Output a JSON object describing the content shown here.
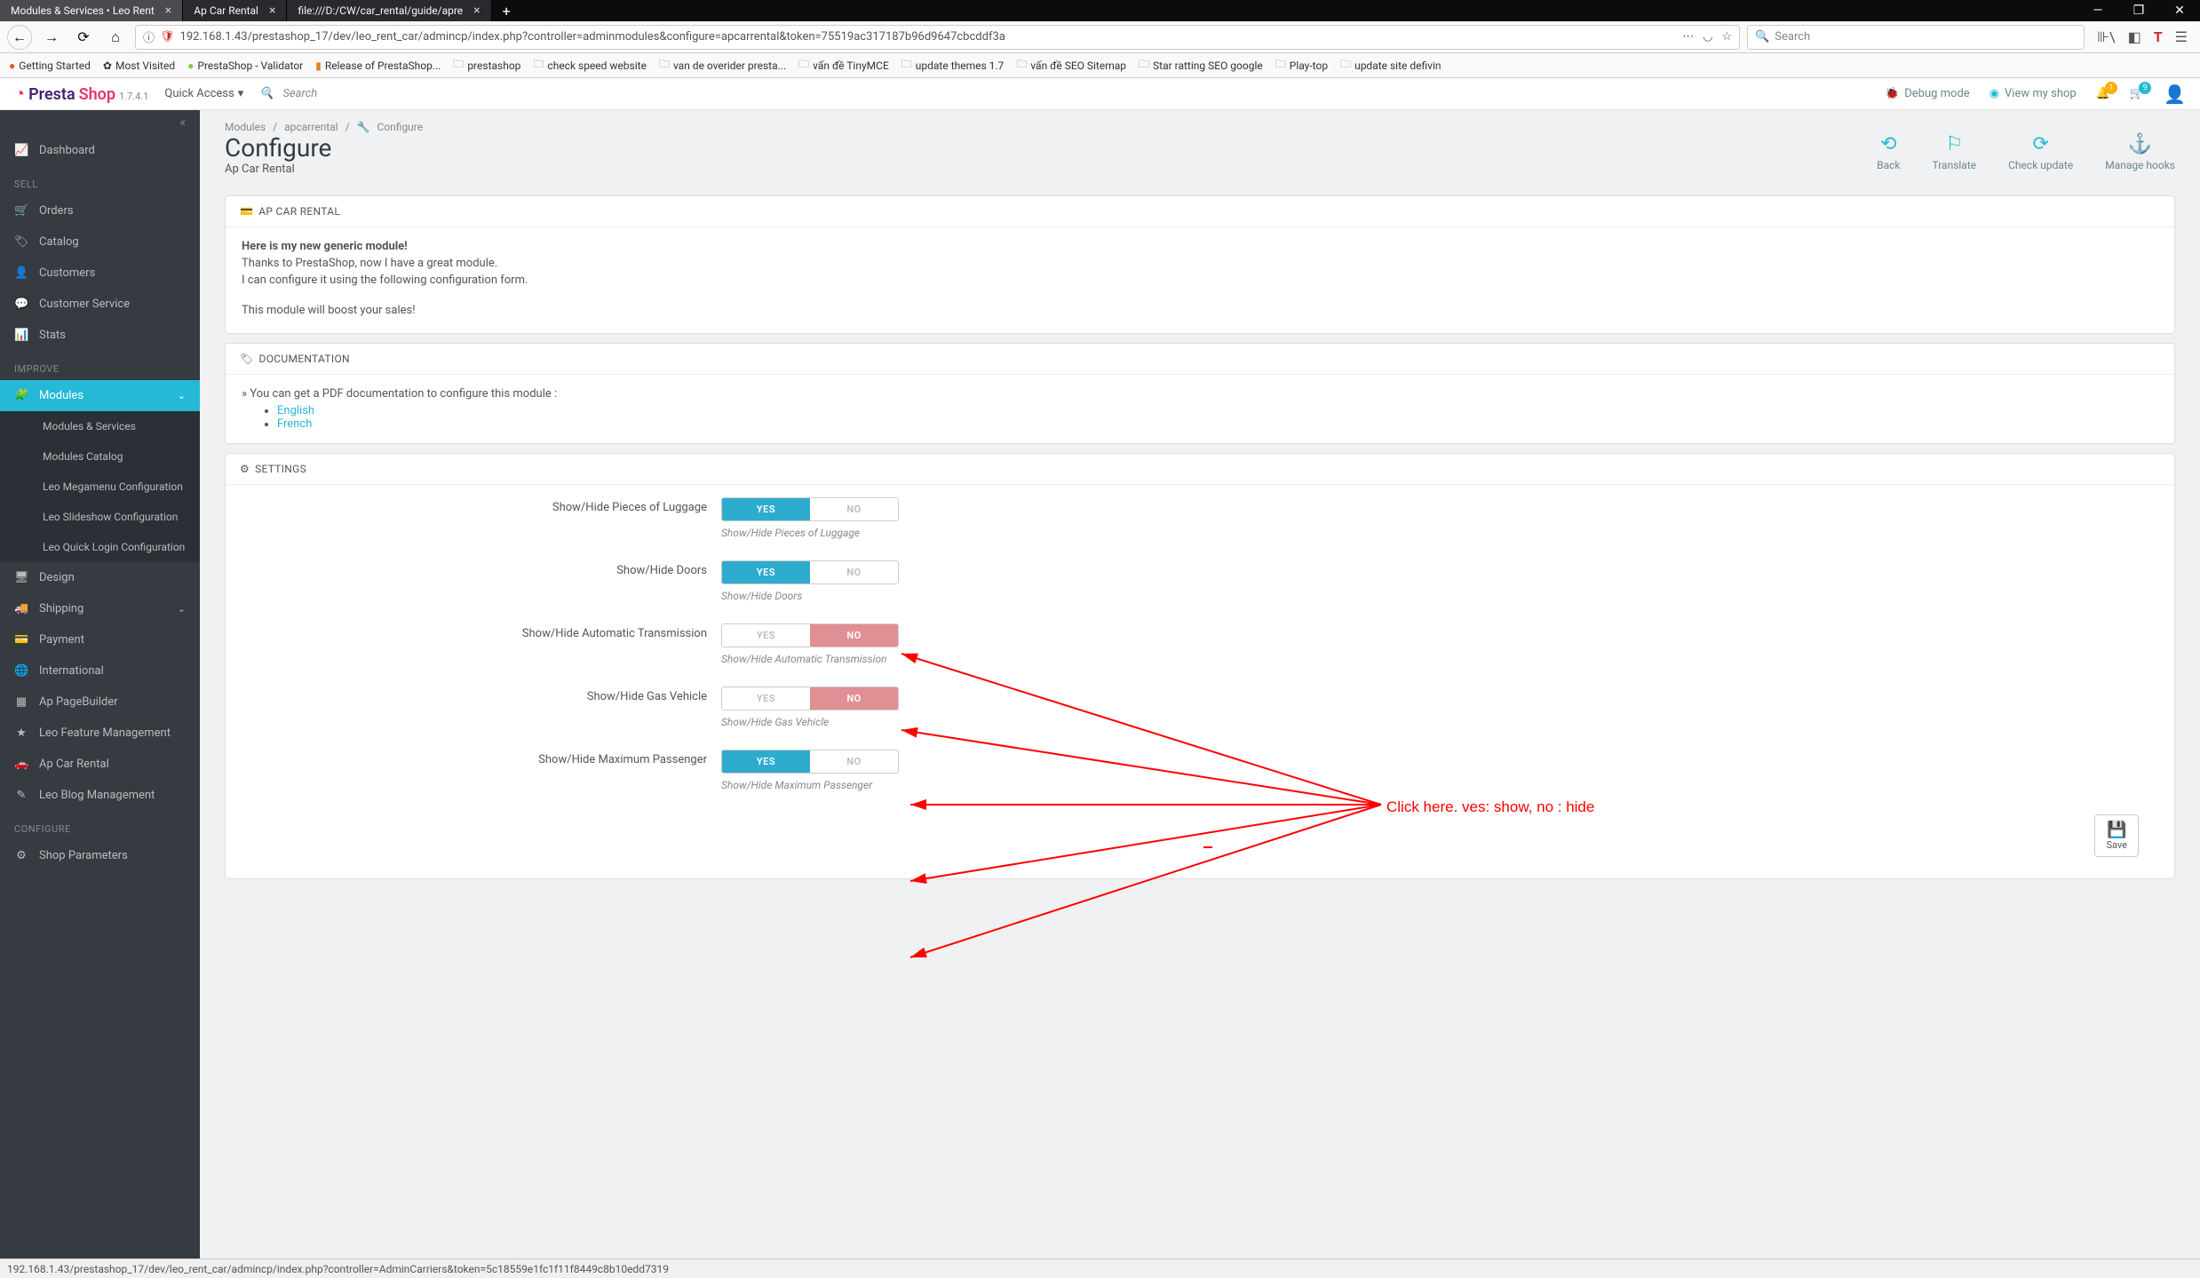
{
  "browser": {
    "tabs": [
      {
        "title": "Modules & Services • Leo Rent",
        "active": true
      },
      {
        "title": "Ap Car Rental",
        "active": false
      },
      {
        "title": "file:///D:/CW/car_rental/guide/apre",
        "active": false
      }
    ],
    "url": "192.168.1.43/prestashop_17/dev/leo_rent_car/admincp/index.php?controller=adminmodules&configure=apcarrental&token=75519ac317187b96d9647cbcddf3a",
    "search_placeholder": "Search",
    "bookmarks": [
      "Getting Started",
      "Most Visited",
      "PrestaShop - Validator",
      "Release of PrestaShop...",
      "prestashop",
      "check speed website",
      "van de overider presta...",
      "vấn đề TinyMCE",
      "update themes 1.7",
      "vấn đề SEO Sitemap",
      "Star ratting SEO google",
      "Play-top",
      "update site defivin"
    ]
  },
  "ps_header": {
    "logo_a": "Presta",
    "logo_b": "Shop",
    "version": "1.7.4.1",
    "quick_access": "Quick Access",
    "search_placeholder": "Search",
    "debug": "Debug mode",
    "view_shop": "View my shop",
    "notif1": "1",
    "notif2": "9"
  },
  "sidebar": {
    "dashboard": "Dashboard",
    "sell_title": "SELL",
    "orders": "Orders",
    "catalog": "Catalog",
    "customers": "Customers",
    "customer_service": "Customer Service",
    "stats": "Stats",
    "improve_title": "IMPROVE",
    "modules": "Modules",
    "modules_services": "Modules & Services",
    "modules_catalog": "Modules Catalog",
    "leo_megamenu": "Leo Megamenu Configuration",
    "leo_slideshow": "Leo Slideshow Configuration",
    "leo_quick_login": "Leo Quick Login Configuration",
    "design": "Design",
    "shipping": "Shipping",
    "payment": "Payment",
    "international": "International",
    "ap_pagebuilder": "Ap PageBuilder",
    "leo_feature": "Leo Feature Management",
    "ap_car_rental": "Ap Car Rental",
    "leo_blog": "Leo Blog Management",
    "configure_title": "CONFIGURE",
    "shop_parameters": "Shop Parameters"
  },
  "breadcrumb": {
    "a": "Modules",
    "b": "apcarrental",
    "c": "Configure"
  },
  "page": {
    "title": "Configure",
    "subtitle": "Ap Car Rental"
  },
  "actions": {
    "back": "Back",
    "translate": "Translate",
    "check_update": "Check update",
    "manage_hooks": "Manage hooks"
  },
  "panel1": {
    "title": "AP CAR RENTAL",
    "line1": "Here is my new generic module!",
    "line2": "Thanks to PrestaShop, now I have a great module.",
    "line3": "I can configure it using the following configuration form.",
    "line4": "This module will boost your sales!"
  },
  "panel2": {
    "title": "DOCUMENTATION",
    "intro": "» You can get a PDF documentation to configure this module :",
    "link1": "English",
    "link2": "French"
  },
  "settings": {
    "title": "SETTINGS",
    "yes": "YES",
    "no": "NO",
    "rows": [
      {
        "label": "Show/Hide Pieces of Luggage",
        "help": "Show/Hide Pieces of Luggage",
        "value": true
      },
      {
        "label": "Show/Hide Doors",
        "help": "Show/Hide Doors",
        "value": true
      },
      {
        "label": "Show/Hide Automatic Transmission",
        "help": "Show/Hide Automatic Transmission",
        "value": false
      },
      {
        "label": "Show/Hide Gas Vehicle",
        "help": "Show/Hide Gas Vehicle",
        "value": false
      },
      {
        "label": "Show/Hide Maximum Passenger",
        "help": "Show/Hide Maximum Passenger",
        "value": true
      }
    ],
    "save": "Save"
  },
  "annotation": "Click here. ves: show, no : hide",
  "status_bar": "192.168.1.43/prestashop_17/dev/leo_rent_car/admincp/index.php?controller=AdminCarriers&token=5c18559e1fc1f11f8449c8b10edd7319"
}
